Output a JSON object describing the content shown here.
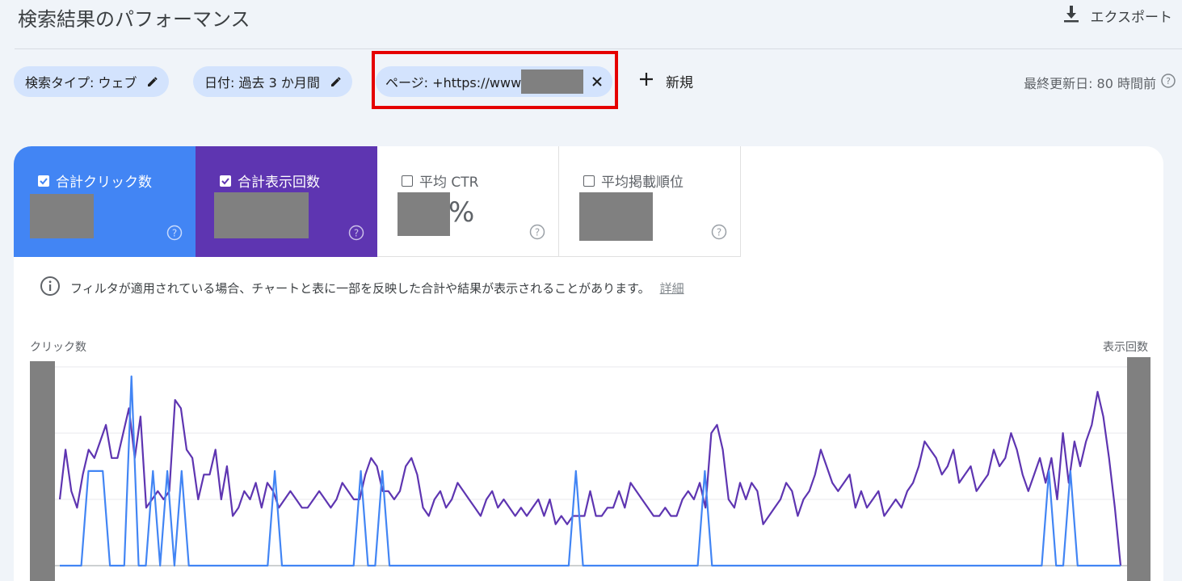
{
  "header": {
    "title": "検索結果のパフォーマンス",
    "export_label": "エクスポート"
  },
  "filters": {
    "chips": [
      {
        "label": "検索タイプ: ウェブ"
      },
      {
        "label": "日付: 過去 3 か月間"
      },
      {
        "label": "ページ: +https://www"
      }
    ],
    "new_label": "新規",
    "last_updated": "最終更新日: 80 時間前"
  },
  "metrics": [
    {
      "label": "合計クリック数",
      "checked": true,
      "color": "#4285f4"
    },
    {
      "label": "合計表示回数",
      "checked": true,
      "color": "#5e35b1"
    },
    {
      "label": "平均 CTR",
      "checked": false,
      "value_suffix": "%"
    },
    {
      "label": "平均掲載順位",
      "checked": false
    }
  ],
  "notice": {
    "text": "フィルタが適用されている場合、チャートと表に一部を反映した合計や結果が表示されることがあります。",
    "link": "詳細"
  },
  "chart_data": {
    "type": "line",
    "ylabel_left": "クリック数",
    "ylabel_right": "表示回数",
    "grid": true,
    "colors": {
      "clicks": "#4285f4",
      "impressions": "#5e35b1"
    },
    "series": [
      {
        "name": "合計表示回数",
        "axis": "right",
        "values": [
          8,
          14,
          9,
          7,
          11,
          14,
          13,
          15,
          17,
          13,
          13,
          16,
          19,
          13,
          18,
          7,
          8,
          9,
          8,
          9,
          20,
          19,
          14,
          13,
          8,
          11,
          11,
          14,
          8,
          12,
          6,
          7,
          9,
          8,
          10,
          7,
          10,
          9,
          7,
          8,
          9,
          8,
          7,
          7,
          8,
          9,
          8,
          7,
          8,
          10,
          9,
          8,
          8,
          11,
          13,
          12,
          9,
          9,
          8,
          9,
          12,
          13,
          11,
          7,
          6,
          8,
          9,
          7,
          8,
          10,
          9,
          8,
          7,
          6,
          8,
          9,
          7,
          8,
          7,
          6,
          7,
          6,
          7,
          8,
          6,
          8,
          5,
          6,
          5,
          6,
          6,
          6,
          9,
          6,
          6,
          7,
          7,
          9,
          7,
          10,
          9,
          8,
          7,
          6,
          6,
          7,
          6,
          6,
          8,
          9,
          8,
          10,
          7,
          16,
          17,
          14,
          8,
          7,
          10,
          8,
          10,
          9,
          5,
          6,
          7,
          8,
          10,
          9,
          6,
          8,
          9,
          11,
          14,
          12,
          10,
          9,
          10,
          11,
          7,
          9,
          7,
          8,
          9,
          6,
          7,
          8,
          7,
          9,
          10,
          12,
          15,
          14,
          13,
          11,
          12,
          14,
          10,
          11,
          12,
          9,
          10,
          11,
          14,
          12,
          13,
          16,
          14,
          11,
          9,
          11,
          13,
          10,
          13,
          8,
          16,
          10,
          15,
          12,
          15,
          17,
          21,
          18,
          13,
          7,
          0
        ]
      },
      {
        "name": "合計クリック数",
        "axis": "left",
        "values": [
          0,
          0,
          0,
          0,
          1,
          1,
          1,
          0,
          0,
          0,
          2,
          0,
          0,
          1,
          0,
          1,
          0,
          1,
          0,
          0,
          0,
          0,
          0,
          0,
          0,
          0,
          0,
          0,
          0,
          0,
          1,
          0,
          0,
          0,
          0,
          0,
          0,
          0,
          0,
          0,
          0,
          0,
          1,
          0,
          0,
          1,
          0,
          0,
          0,
          0,
          0,
          0,
          0,
          0,
          0,
          0,
          0,
          0,
          0,
          0,
          0,
          0,
          0,
          0,
          0,
          0,
          0,
          0,
          0,
          0,
          0,
          0,
          1,
          0,
          0,
          0,
          0,
          0,
          0,
          0,
          0,
          0,
          0,
          0,
          0,
          0,
          0,
          0,
          0,
          0,
          1,
          0,
          0,
          0,
          0,
          0,
          0,
          0,
          0,
          0,
          0,
          0,
          0,
          0,
          0,
          0,
          0,
          0,
          0,
          0,
          0,
          0,
          0,
          0,
          0,
          0,
          0,
          0,
          0,
          0,
          0,
          0,
          0,
          0,
          0,
          0,
          0,
          0,
          0,
          0,
          0,
          0,
          0,
          0,
          0,
          0,
          0,
          0,
          1,
          0,
          0,
          1,
          0,
          0,
          0,
          0,
          0,
          0,
          0
        ]
      }
    ]
  }
}
